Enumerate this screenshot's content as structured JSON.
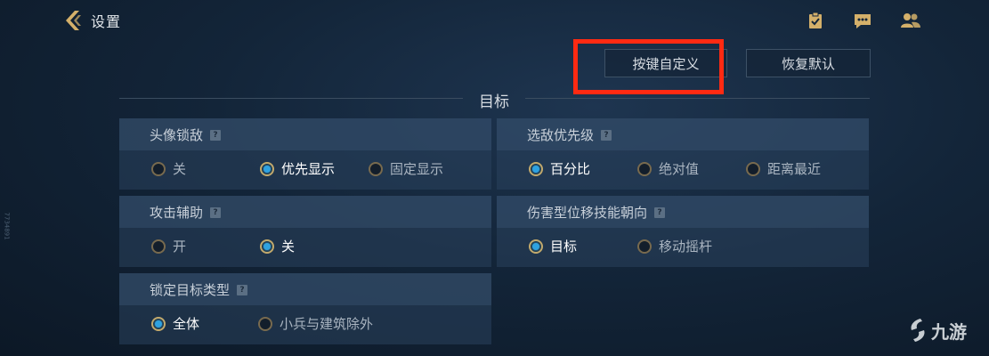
{
  "header": {
    "title": "设置",
    "icons": [
      "clipboard-check-icon",
      "chat-icon",
      "friends-icon"
    ]
  },
  "buttons": {
    "key_custom": "按键自定义",
    "restore_default": "恢复默认"
  },
  "section": {
    "title": "目标"
  },
  "settings": [
    {
      "label": "头像锁敌",
      "options": [
        "关",
        "优先显示",
        "固定显示"
      ],
      "selected": "优先显示"
    },
    {
      "label": "选敌优先级",
      "options": [
        "百分比",
        "绝对值",
        "距离最近"
      ],
      "selected": "百分比"
    },
    {
      "label": "攻击辅助",
      "options": [
        "开",
        "关"
      ],
      "selected": "关"
    },
    {
      "label": "伤害型位移技能朝向",
      "options": [
        "目标",
        "移动摇杆"
      ],
      "selected": "目标"
    },
    {
      "label": "锁定目标类型",
      "options": [
        "全体",
        "小兵与建筑除外"
      ],
      "selected": "全体"
    }
  ],
  "help_mark": "?",
  "watermark": {
    "text": "九游"
  },
  "side_id": "7734891",
  "colors": {
    "highlight": "#ff2a12",
    "accent_gold": "#c9a865",
    "radio_blue": "#2fa2e0"
  }
}
